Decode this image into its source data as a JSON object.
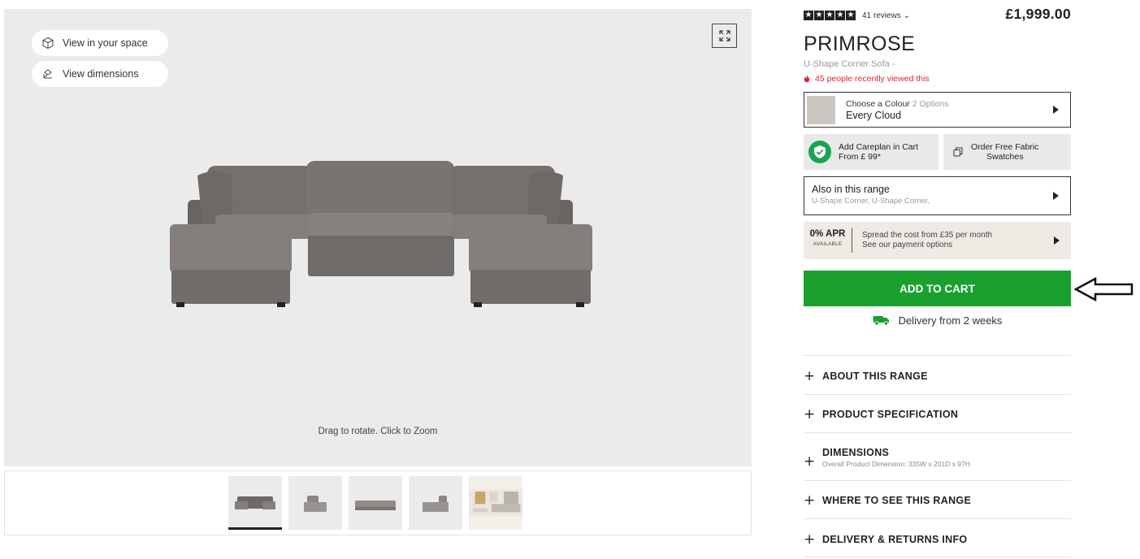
{
  "viewer": {
    "view_space_label": "View in your space",
    "view_dimensions_label": "View dimensions",
    "hint": "Drag to rotate. Click to Zoom",
    "background": "#ebebeb"
  },
  "thumbnails": [
    {
      "name": "thumb-front-view",
      "active": true
    },
    {
      "name": "thumb-side-view",
      "active": false
    },
    {
      "name": "thumb-back-view",
      "active": false
    },
    {
      "name": "thumb-angle-view",
      "active": false
    },
    {
      "name": "thumb-room-view",
      "active": false
    }
  ],
  "product": {
    "rating_stars": 5,
    "reviews_label": "41 reviews ⌄",
    "price": "£1,999.00",
    "title": "PRIMROSE",
    "subtitle": "U-Shape Corner Sofa -",
    "viewed_text": "45 people recently viewed this"
  },
  "colour": {
    "label": "Choose a Colour",
    "options_count": "2 Options",
    "value": "Every Cloud",
    "swatch_color": "#cdc7c2"
  },
  "careplan": {
    "line1": "Add Careplan in Cart",
    "line2": "From  £ 99*"
  },
  "swatches": {
    "line1": "Order Free Fabric",
    "line2": "Swatches"
  },
  "range": {
    "title": "Also in this range",
    "subtitle": "U-Shape Corner, U-Shape Corner,"
  },
  "finance": {
    "apr": "0% APR",
    "available": "AVAILABLE",
    "line1": "Spread the cost from £35 per month",
    "line2": "See our payment options"
  },
  "cart": {
    "label": "ADD TO CART",
    "color": "#1aa02f"
  },
  "delivery": {
    "text": "Delivery from 2 weeks"
  },
  "accordion": [
    {
      "title": "ABOUT THIS RANGE",
      "sub": ""
    },
    {
      "title": "PRODUCT SPECIFICATION",
      "sub": ""
    },
    {
      "title": "DIMENSIONS",
      "sub": "Overall Product Dimension: 335W x 201D x 97H"
    },
    {
      "title": "WHERE TO SEE THIS RANGE",
      "sub": ""
    },
    {
      "title": "DELIVERY & RETURNS INFO",
      "sub": ""
    }
  ],
  "icons": {
    "cube": "cube-icon",
    "dimensions": "dimensions-icon",
    "expand": "expand-icon",
    "flame": "flame-icon",
    "shield": "shield-check-icon",
    "copy": "copy-icon",
    "truck": "truck-icon",
    "arrow": "arrow-left-outline-icon"
  }
}
